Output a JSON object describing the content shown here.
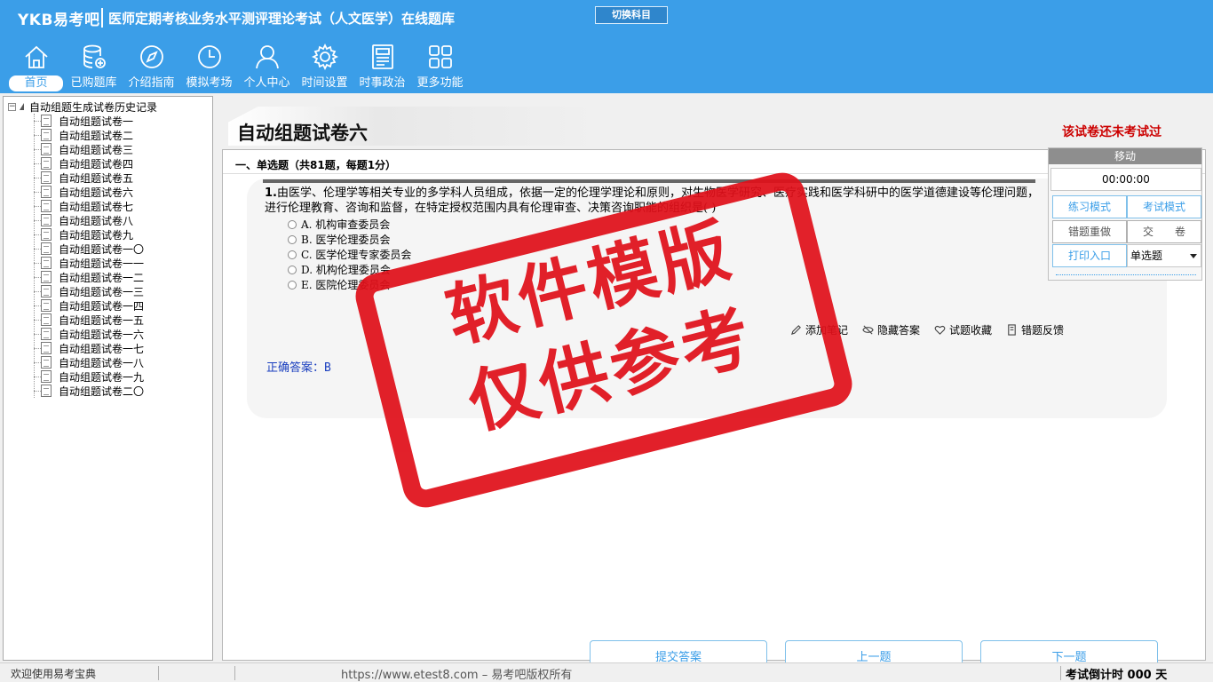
{
  "header": {
    "brand": "YKB易考吧",
    "title": "医师定期考核业务水平测评理论考试（人文医学）在线题库",
    "switch_subject": "切换科目"
  },
  "nav": [
    {
      "label": "首页",
      "icon": "home-icon"
    },
    {
      "label": "已购题库",
      "icon": "database-icon"
    },
    {
      "label": "介绍指南",
      "icon": "compass-icon"
    },
    {
      "label": "模拟考场",
      "icon": "clock-icon"
    },
    {
      "label": "个人中心",
      "icon": "user-icon"
    },
    {
      "label": "时间设置",
      "icon": "gear-icon"
    },
    {
      "label": "时事政治",
      "icon": "newspaper-icon"
    },
    {
      "label": "更多功能",
      "icon": "grid-icon"
    }
  ],
  "tree": {
    "expander": "−",
    "root": "自动组题生成试卷历史记录",
    "items": [
      "自动组题试卷一",
      "自动组题试卷二",
      "自动组题试卷三",
      "自动组题试卷四",
      "自动组题试卷五",
      "自动组题试卷六",
      "自动组题试卷七",
      "自动组题试卷八",
      "自动组题试卷九",
      "自动组题试卷一〇",
      "自动组题试卷一一",
      "自动组题试卷一二",
      "自动组题试卷一三",
      "自动组题试卷一四",
      "自动组题试卷一五",
      "自动组题试卷一六",
      "自动组题试卷一七",
      "自动组题试卷一八",
      "自动组题试卷一九",
      "自动组题试卷二〇"
    ]
  },
  "main": {
    "paper_title": "自动组题试卷六",
    "not_taken": "该试卷还未考试过",
    "section_head": "一、单选题（共81题，每题1分）",
    "question": {
      "number": "1.",
      "text": "由医学、伦理学等相关专业的多学科人员组成，依据一定的伦理学理论和原则，对生物医学研究、医疗实践和医学科研中的医学道德建设等伦理问题，进行伦理教育、咨询和监督，在特定授权范围内具有伦理审查、决策咨询职能的组织是(    )",
      "options": [
        "A. 机构审查委员会",
        "B. 医学伦理委员会",
        "C. 医学伦理专家委员会",
        "D. 机构伦理委员会",
        "E. 医院伦理委员会"
      ]
    },
    "tools": [
      "添加笔记",
      "隐藏答案",
      "试题收藏",
      "错题反馈"
    ],
    "answer": "正确答案：B",
    "buttons": {
      "submit": "提交答案",
      "prev": "上一题",
      "next": "下一题"
    },
    "scroll_glyphs": {
      "left": "◂",
      "grip": "⦀",
      "right": "▸"
    }
  },
  "panel": {
    "move": "移动",
    "timer": "00:00:00",
    "practice_mode": "练习模式",
    "exam_mode": "考试模式",
    "redo_wrong": "错题重做",
    "hand_in": "交　　卷",
    "print": "打印入口",
    "question_type": "单选题"
  },
  "watermark": {
    "line1": "软件模版",
    "line2": "仅供参考"
  },
  "status": {
    "welcome": "欢迎使用易考宝典",
    "copyright": "https://www.etest8.com – 易考吧版权所有",
    "countdown": "考试倒计时 000 天"
  },
  "colors": {
    "header": "#3b9ee8",
    "alert": "#cc0000",
    "answer": "#1a3fbf",
    "stamp": "#e0101a"
  }
}
